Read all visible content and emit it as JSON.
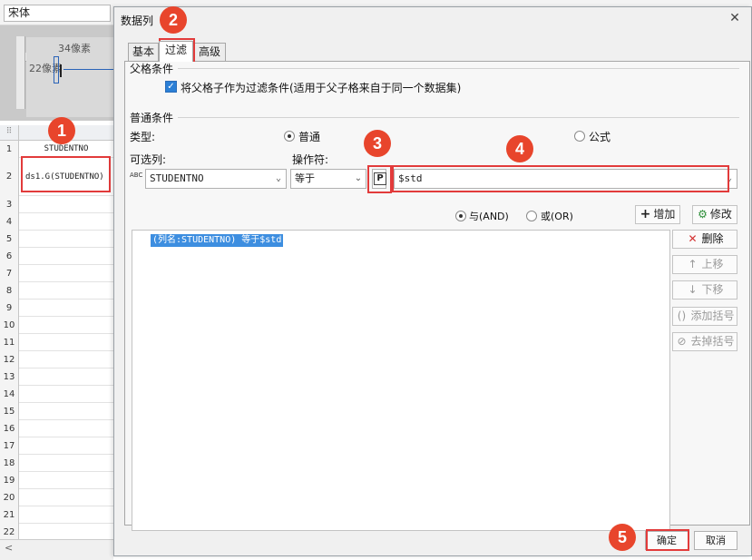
{
  "app": {
    "font_name": "宋体",
    "ruler_mark": "0",
    "width_label": "34像素",
    "height_label": "22像素",
    "grid_corner": "⠿",
    "column_header": "STUDENTNO",
    "rows": [
      {
        "num": "1",
        "value": "STUDENTNO"
      },
      {
        "num": "2",
        "value": "ds1.G(STUDENTNO)"
      },
      {
        "num": "3",
        "value": ""
      },
      {
        "num": "4",
        "value": ""
      },
      {
        "num": "5",
        "value": ""
      },
      {
        "num": "6",
        "value": ""
      },
      {
        "num": "7",
        "value": ""
      },
      {
        "num": "8",
        "value": ""
      },
      {
        "num": "9",
        "value": ""
      },
      {
        "num": "10",
        "value": ""
      },
      {
        "num": "11",
        "value": ""
      },
      {
        "num": "12",
        "value": ""
      },
      {
        "num": "13",
        "value": ""
      },
      {
        "num": "14",
        "value": ""
      },
      {
        "num": "15",
        "value": ""
      },
      {
        "num": "16",
        "value": ""
      },
      {
        "num": "17",
        "value": ""
      },
      {
        "num": "18",
        "value": ""
      },
      {
        "num": "19",
        "value": ""
      },
      {
        "num": "20",
        "value": ""
      },
      {
        "num": "21",
        "value": ""
      },
      {
        "num": "22",
        "value": ""
      }
    ],
    "scroll_left": "<"
  },
  "dialog": {
    "title": "数据列",
    "close": "✕",
    "tabs": [
      "基本",
      "过滤",
      "高级"
    ],
    "parent_condition": {
      "group_label": "父格条件",
      "checkbox_label": "将父格子作为过滤条件(适用于父子格来自于同一个数据集)",
      "checked": true
    },
    "normal_condition": {
      "group_label": "普通条件",
      "type_label": "类型:",
      "type_options": [
        "普通",
        "公式"
      ],
      "selected_type": "普通",
      "column_label": "可选列:",
      "column_value": "STUDENTNO",
      "column_icon_text": "ABC",
      "operator_label": "操作符:",
      "operator_value": "等于",
      "param_button": "P",
      "value": "$std"
    },
    "logic": {
      "and_label": "与(AND)",
      "or_label": "或(OR)",
      "selected": "and"
    },
    "add_button": "增加",
    "modify_button": "修改",
    "conditions": [
      "(列名:STUDENTNO) 等于$std"
    ],
    "side_buttons": {
      "delete": "删除",
      "up": "上移",
      "down": "下移",
      "add_bracket": "添加括号",
      "remove_bracket": "去掉括号"
    },
    "ok": "确定",
    "cancel": "取消"
  },
  "callouts": [
    "1",
    "2",
    "3",
    "4",
    "5"
  ],
  "colors": {
    "callout": "#e8452c",
    "highlight": "#e23b3b",
    "selection": "#3d8ee0",
    "checkbox": "#2b7fd6"
  }
}
